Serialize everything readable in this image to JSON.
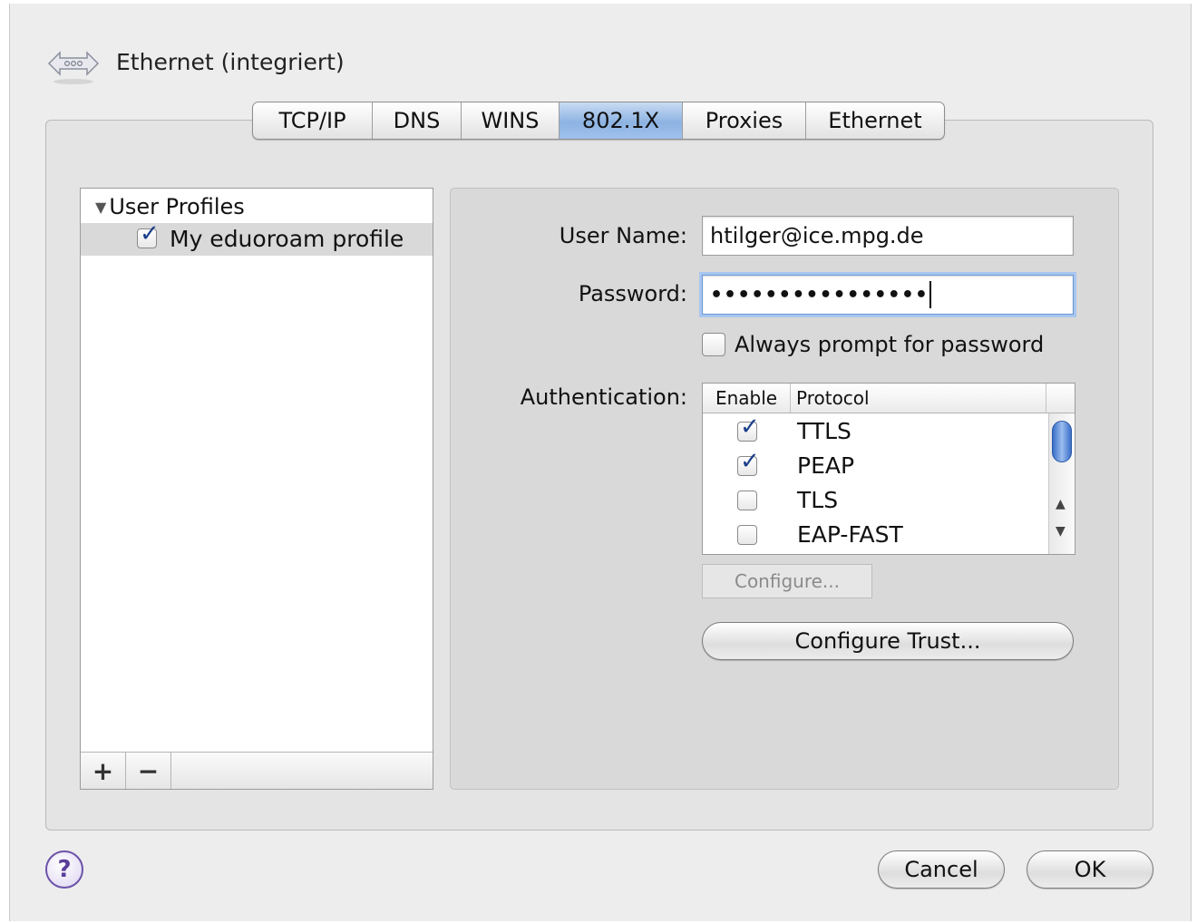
{
  "window": {
    "title": "Ethernet (integriert)",
    "icon": "network-arrows-icon"
  },
  "tabs": [
    {
      "label": "TCP/IP",
      "active": false
    },
    {
      "label": "DNS",
      "active": false
    },
    {
      "label": "WINS",
      "active": false
    },
    {
      "label": "802.1X",
      "active": true
    },
    {
      "label": "Proxies",
      "active": false
    },
    {
      "label": "Ethernet",
      "active": false
    }
  ],
  "profiles": {
    "group_label": "User Profiles",
    "items": [
      {
        "label": "My eduoroam profile",
        "checked": true,
        "selected": true
      }
    ],
    "add_label": "+",
    "remove_label": "−"
  },
  "form": {
    "username_label": "User Name:",
    "username_value": "htilger@ice.mpg.de",
    "password_label": "Password:",
    "password_value": "••••••••••••••••",
    "always_prompt_label": "Always prompt for password",
    "always_prompt_checked": false,
    "auth_label": "Authentication:"
  },
  "auth_table": {
    "columns": [
      "Enable",
      "Protocol"
    ],
    "rows": [
      {
        "protocol": "TTLS",
        "enabled": true
      },
      {
        "protocol": "PEAP",
        "enabled": true
      },
      {
        "protocol": "TLS",
        "enabled": false
      },
      {
        "protocol": "EAP-FAST",
        "enabled": false
      }
    ]
  },
  "buttons": {
    "configure": "Configure...",
    "configure_trust": "Configure Trust...",
    "cancel": "Cancel",
    "ok": "OK",
    "help": "?"
  },
  "colors": {
    "active_tab": "#8db3e2",
    "focus_ring": "#a8c6ef",
    "checkmark": "#1a3f8a",
    "help_icon": "#6b52a8"
  }
}
